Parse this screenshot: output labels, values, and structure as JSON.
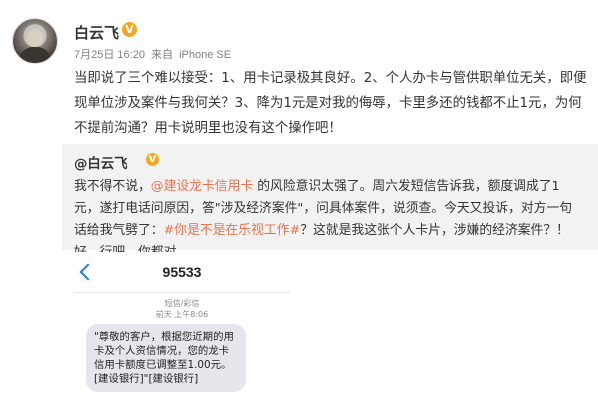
{
  "post": {
    "author": "白云飞",
    "verified_badge": "V",
    "date": "7月25日 16:20",
    "source_prefix": "来自",
    "source": "iPhone SE",
    "text": "当即说了三个难以接受：1、用卡记录极其良好。2、个人办卡与管供职单位无关，即便现单位涉及案件与我何关？3、降为1元是对我的侮辱，卡里多还的钱都不止1元，为何不提前沟通？用卡说明里也没有这个操作吧！"
  },
  "repost": {
    "author": "@白云飞",
    "verified_badge": "V",
    "text_part1": "我不得不说，",
    "link_bank": "@建设龙卡信用卡",
    "text_part2": " 的风险意识太强了。周六发短信告诉我，额度调成了1元，遂打电话问原因，答\"涉及经济案件\"，问具体案件，说须查。今天又投诉，对方一句话给我气劈了：",
    "link_topic": "#你是不是在乐视工作#",
    "text_part3": "？这就是我这张个人卡片，涉嫌的经济案件？！好，行吧，你都对。"
  },
  "sms": {
    "sender": "95533",
    "message_type": "短信/彩信",
    "timestamp": "前天 上午8:06",
    "body": "\"尊敬的客户，根据您近期的用卡及个人资信情况，您的龙卡信用卡额度已调整至1.00元。[建设银行]\"[建设银行]"
  },
  "colors": {
    "link": "#eb7350",
    "badge": "#f5a623",
    "back_arrow": "#1a7cf0",
    "repost_bg": "#f2f2f2"
  }
}
